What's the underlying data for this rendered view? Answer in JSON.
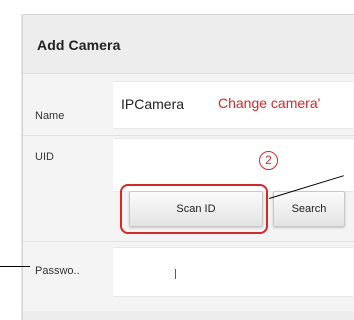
{
  "dialog": {
    "title": "Add Camera"
  },
  "fields": {
    "name_label": "Name",
    "name_value": "IPCamera",
    "uid_label": "UID",
    "uid_value": "",
    "password_label": "Passwo..",
    "password_value": ""
  },
  "buttons": {
    "scan_label": "Scan ID",
    "search_label": "Search"
  },
  "annotations": {
    "name_note": "Change camera'",
    "step_number": "2",
    "accent_color": "#d3292a"
  }
}
